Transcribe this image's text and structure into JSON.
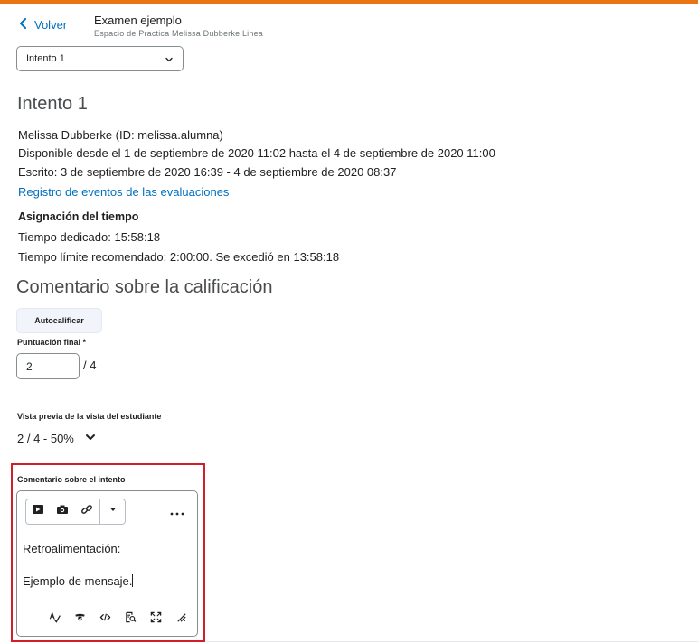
{
  "header": {
    "back_label": "Volver",
    "title": "Examen ejemplo",
    "subtitle": "Espacio de Practica Melissa Dubberke Linea"
  },
  "attempt_select": {
    "selected": "Intento 1"
  },
  "attempt": {
    "heading": "Intento 1",
    "student": "Melissa Dubberke (ID: melissa.alumna)",
    "available": "Disponible desde el 1 de septiembre de 2020 11:02 hasta el 4 de septiembre de 2020 11:00",
    "written": "Escrito: 3 de septiembre de 2020 16:39 - 4 de septiembre de 2020 08:37",
    "event_log_link": "Registro de eventos de las evaluaciones"
  },
  "time": {
    "heading": "Asignación del tiempo",
    "spent": "Tiempo dedicado: 15:58:18",
    "limit": "Tiempo límite recomendado: 2:00:00. Se excedió en 13:58:18"
  },
  "grade": {
    "heading": "Comentario sobre la calificación",
    "autograde_label": "Autocalificar",
    "final_score_label": "Puntuación final *",
    "score_value": "2",
    "score_out_of": "/ 4",
    "preview_label": "Vista previa de la vista del estudiante",
    "preview_value": "2 / 4 - 50%"
  },
  "comment": {
    "label": "Comentario sobre el intento",
    "line1": "Retroalimentación:",
    "line2": "Ejemplo de mensaje."
  },
  "colors": {
    "accent": "#e87511",
    "link": "#006fbf",
    "highlight": "#d21d2b"
  },
  "icons": {
    "toolbar": [
      "video-icon",
      "camera-icon",
      "link-icon",
      "caret-down-icon",
      "more-options-icon"
    ],
    "bottom": [
      "spellcheck-icon",
      "accessibility-check-icon",
      "source-code-icon",
      "preview-icon",
      "fullscreen-icon",
      "resize-handle-icon"
    ]
  }
}
